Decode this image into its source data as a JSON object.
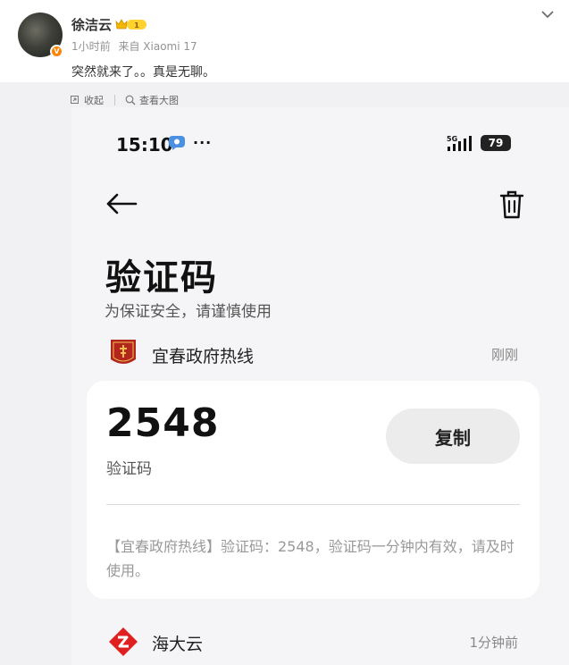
{
  "post": {
    "username": "徐洁云",
    "member_level": "1",
    "time": "1小时前",
    "source": "来自 Xiaomi 17",
    "text": "突然就来了。。真是无聊。",
    "avatar_badge": "V"
  },
  "image_toolbar": {
    "collapse_label": "收起",
    "view_full_label": "查看大图"
  },
  "phone": {
    "status_bar": {
      "time": "15:10",
      "dots": "···",
      "network": "5G",
      "battery": "79"
    },
    "header": {
      "title": "验证码",
      "subtitle": "为保证安全，请谨慎使用"
    },
    "messages": [
      {
        "sender": "宜春政府热线",
        "time": "刚刚",
        "code": "2548",
        "code_label": "验证码",
        "copy_label": "复制",
        "body": "【宜春政府热线】验证码：2548，验证码一分钟内有效，请及时使用。"
      },
      {
        "sender": "海大云",
        "time": "1分钟前"
      }
    ]
  },
  "colors": {
    "accent_weibo": "#ff8200",
    "member_gold": "#f5b800",
    "sender1_logo": "#b3261e",
    "sender2_logo": "#e02020",
    "card_bg": "#ffffff",
    "screen_bg": "#f5f5f7"
  }
}
